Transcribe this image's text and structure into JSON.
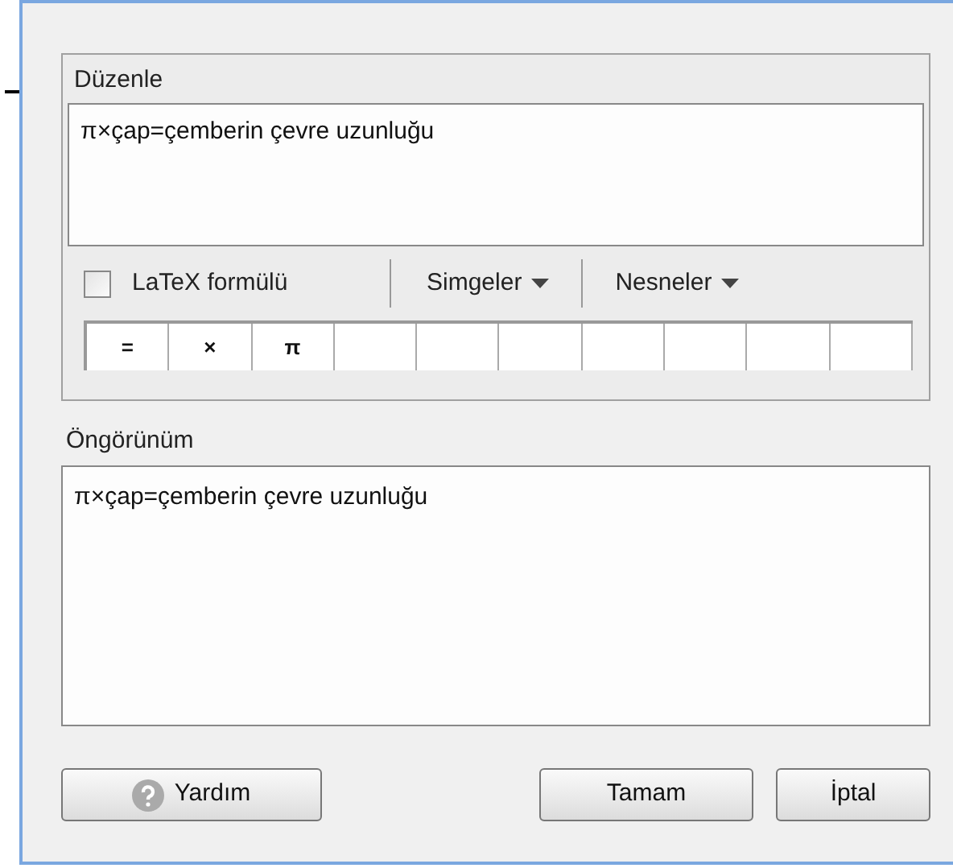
{
  "edit_panel": {
    "title": "Düzenle",
    "text": "π×çap=çemberin çevre uzunluğu"
  },
  "latex_checkbox": {
    "label": "LaTeX formülü",
    "checked": false
  },
  "menus": [
    "Simgeler",
    "Nesneler"
  ],
  "symbols": [
    "=",
    "×",
    "π"
  ],
  "preview": {
    "title": "Öngörünüm",
    "text": "π×çap=çemberin çevre uzunluğu"
  },
  "buttons": [
    {
      "kind": "help",
      "label": "Yardım"
    },
    {
      "kind": "plain",
      "label": "Tamam"
    },
    {
      "kind": "plain",
      "label": "İptal"
    }
  ]
}
